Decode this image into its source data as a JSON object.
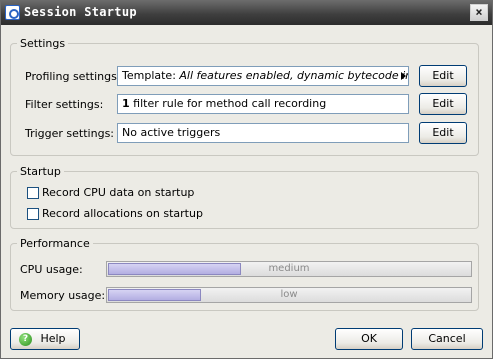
{
  "window": {
    "title": "Session Startup",
    "close_glyph": "×"
  },
  "settings": {
    "group_title": "Settings",
    "profiling": {
      "label": "Profiling settings:",
      "value_prefix": "Template: ",
      "value_italic": "All features enabled, dynamic bytecode instrun",
      "edit_label": "Edit"
    },
    "filter": {
      "label": "Filter settings:",
      "value_count": "1",
      "value_rest": " filter rule for method call recording",
      "edit_label": "Edit"
    },
    "trigger": {
      "label": "Trigger settings:",
      "value": "No active triggers",
      "edit_label": "Edit"
    }
  },
  "startup": {
    "group_title": "Startup",
    "record_cpu": {
      "label": "Record CPU data on startup",
      "checked": false
    },
    "record_alloc": {
      "label": "Record allocations on startup",
      "checked": false
    }
  },
  "performance": {
    "group_title": "Performance",
    "cpu": {
      "label": "CPU usage:",
      "level_text": "medium",
      "level_fraction": 0.37
    },
    "memory": {
      "label": "Memory usage:",
      "level_text": "low",
      "level_fraction": 0.26
    }
  },
  "footer": {
    "help_label": "Help",
    "ok_label": "OK",
    "cancel_label": "Cancel"
  }
}
